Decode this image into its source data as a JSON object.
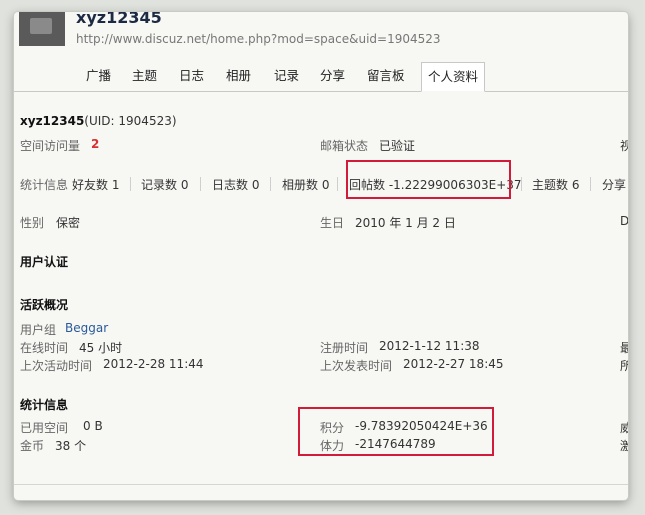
{
  "header": {
    "username": "xyz12345",
    "url": "http://www.discuz.net/home.php?mod=space&uid=1904523"
  },
  "tabs": [
    "广播",
    "主题",
    "日志",
    "相册",
    "记录",
    "分享",
    "留言板",
    "个人资料"
  ],
  "profile": {
    "name": "xyz12345",
    "uid_text": "(UID: 1904523)",
    "visits_label": "空间访问量",
    "visits_value": "2",
    "email_label": "邮箱状态",
    "email_value": "已验证",
    "right_cut_1": "视",
    "stats_label": "统计信息",
    "stats": [
      {
        "label": "好友数",
        "value": "1"
      },
      {
        "label": "记录数",
        "value": "0"
      },
      {
        "label": "日志数",
        "value": "0"
      },
      {
        "label": "相册数",
        "value": "0"
      },
      {
        "label": "回帖数",
        "value": "-1.22299006303E+37"
      },
      {
        "label": "主题数",
        "value": "6"
      },
      {
        "label": "分享",
        "value": ""
      }
    ],
    "gender_label": "性别",
    "gender_value": "保密",
    "birthday_label": "生日",
    "birthday_value": "2010 年 1 月 2 日",
    "right_cut_2": "D"
  },
  "auth": {
    "title": "用户认证"
  },
  "activity": {
    "title": "活跃概况",
    "group_label": "用户组",
    "group_value": "Beggar",
    "online_label": "在线时间",
    "online_value": "45 小时",
    "reg_label": "注册时间",
    "reg_value": "2012-1-12 11:38",
    "right_cut_3": "最",
    "last_active_label": "上次活动时间",
    "last_active_value": "2012-2-28 11:44",
    "last_post_label": "上次发表时间",
    "last_post_value": "2012-2-27 18:45",
    "right_cut_4": "所"
  },
  "stats_info": {
    "title": "统计信息",
    "space_label": "已用空间",
    "space_value": "0 B",
    "points_label": "积分",
    "points_value": "-9.78392050424E+36",
    "coins_label": "金币",
    "coins_value": "38 个",
    "energy_label": "体力",
    "energy_value": "-2147644789",
    "right_cut_5": "威",
    "right_cut_6": "激"
  },
  "colors": {
    "highlight": "#d21a3a",
    "link": "#2a5a9a",
    "visits": "#d83030"
  }
}
